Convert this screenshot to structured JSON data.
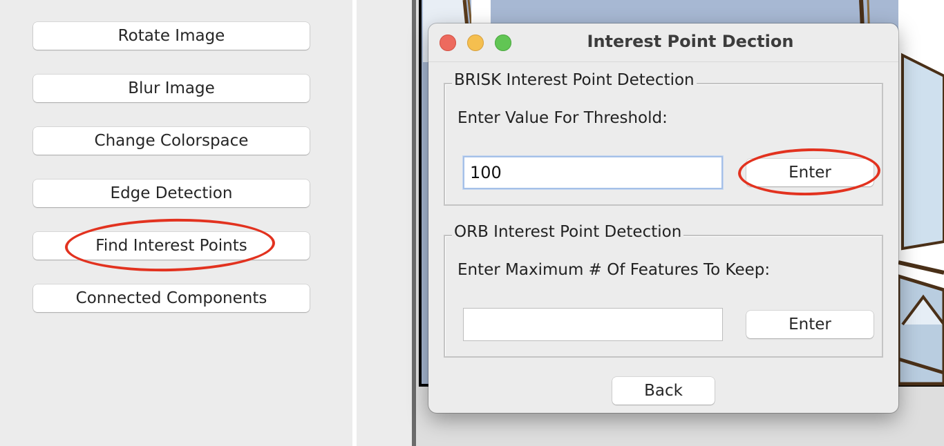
{
  "sidebar": {
    "buttons": [
      {
        "label": "Rotate Image"
      },
      {
        "label": "Blur Image"
      },
      {
        "label": "Change Colorspace"
      },
      {
        "label": "Edge Detection"
      },
      {
        "label": "Find Interest Points"
      },
      {
        "label": "Connected Components"
      }
    ]
  },
  "dialog": {
    "title": "Interest Point Dection",
    "brisk": {
      "legend": "BRISK Interest Point Detection",
      "prompt": "Enter Value For Threshold:",
      "input_value": "100",
      "enter_label": "Enter"
    },
    "orb": {
      "legend": "ORB Interest Point Detection",
      "prompt": "Enter Maximum # Of Features To Keep:",
      "input_value": "",
      "enter_label": "Enter"
    },
    "back_label": "Back"
  },
  "colors": {
    "annotation": "#e2321f",
    "window_bg": "#ececec",
    "focus_ring": "#a5c0e8",
    "close": "#ed6a5e",
    "minimize": "#f5bf4f",
    "maximize": "#61c554"
  }
}
